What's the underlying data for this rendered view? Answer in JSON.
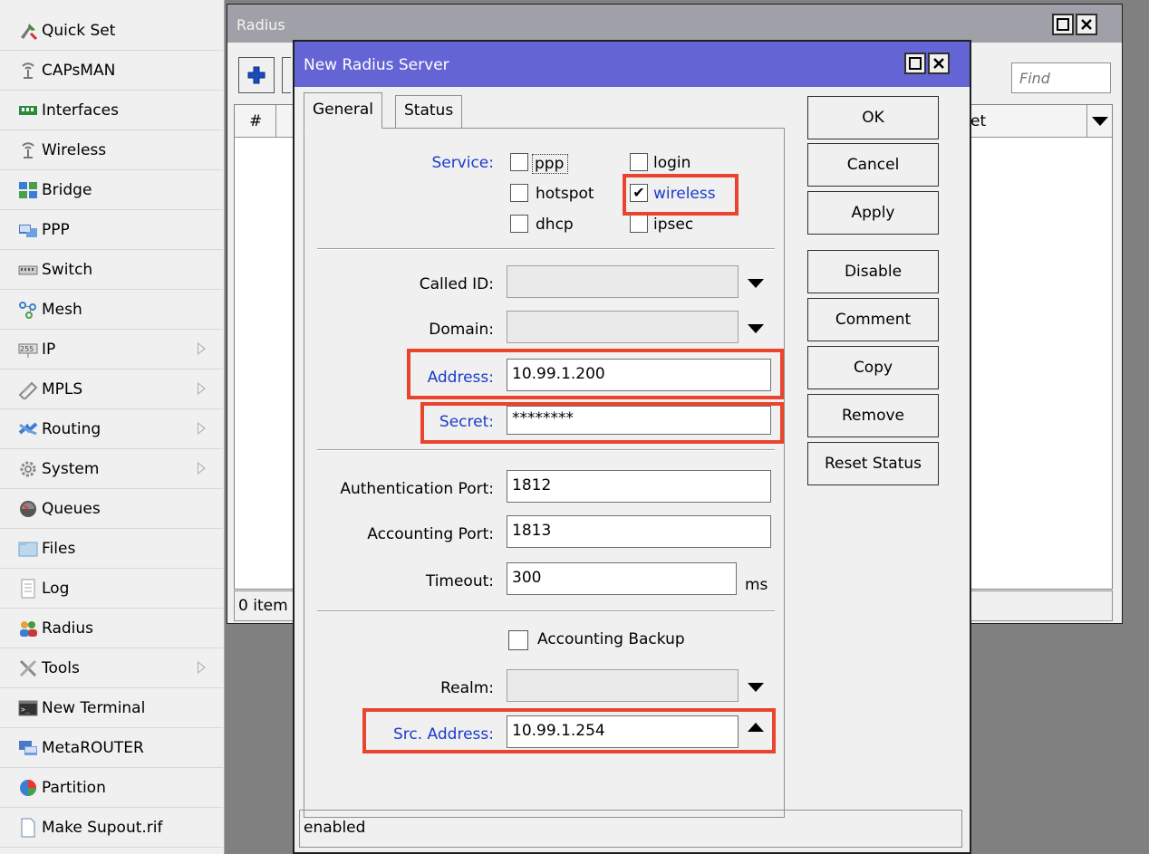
{
  "sidebar": {
    "items": [
      {
        "label": "Quick Set",
        "icon": "quick-set-icon",
        "arrow": false
      },
      {
        "label": "CAPsMAN",
        "icon": "antenna-icon",
        "arrow": false
      },
      {
        "label": "Interfaces",
        "icon": "interfaces-icon",
        "arrow": false
      },
      {
        "label": "Wireless",
        "icon": "wireless-icon",
        "arrow": false
      },
      {
        "label": "Bridge",
        "icon": "bridge-icon",
        "arrow": false
      },
      {
        "label": "PPP",
        "icon": "ppp-icon",
        "arrow": false
      },
      {
        "label": "Switch",
        "icon": "switch-icon",
        "arrow": false
      },
      {
        "label": "Mesh",
        "icon": "mesh-icon",
        "arrow": false
      },
      {
        "label": "IP",
        "icon": "ip-icon",
        "arrow": true
      },
      {
        "label": "MPLS",
        "icon": "mpls-icon",
        "arrow": true
      },
      {
        "label": "Routing",
        "icon": "routing-icon",
        "arrow": true
      },
      {
        "label": "System",
        "icon": "system-gear-icon",
        "arrow": true
      },
      {
        "label": "Queues",
        "icon": "queues-icon",
        "arrow": false
      },
      {
        "label": "Files",
        "icon": "folder-icon",
        "arrow": false
      },
      {
        "label": "Log",
        "icon": "log-icon",
        "arrow": false
      },
      {
        "label": "Radius",
        "icon": "radius-users-icon",
        "arrow": false
      },
      {
        "label": "Tools",
        "icon": "tools-icon",
        "arrow": true
      },
      {
        "label": "New Terminal",
        "icon": "terminal-icon",
        "arrow": false
      },
      {
        "label": "MetaROUTER",
        "icon": "metarouter-icon",
        "arrow": false
      },
      {
        "label": "Partition",
        "icon": "partition-icon",
        "arrow": false
      },
      {
        "label": "Make Supout.rif",
        "icon": "document-icon",
        "arrow": false
      }
    ]
  },
  "radius_window": {
    "title": "Radius",
    "add_icon": "plus-icon",
    "find_placeholder": "Find",
    "col_num": "#",
    "col_partial": "et",
    "status": "0 item"
  },
  "dialog": {
    "title": "New Radius Server",
    "tabs": [
      "General",
      "Status"
    ],
    "service": {
      "label": "Service:",
      "options": [
        {
          "label": "ppp",
          "checked": false
        },
        {
          "label": "login",
          "checked": false
        },
        {
          "label": "hotspot",
          "checked": false
        },
        {
          "label": "wireless",
          "checked": true
        },
        {
          "label": "dhcp",
          "checked": false
        },
        {
          "label": "ipsec",
          "checked": false
        }
      ]
    },
    "fields": {
      "called_id": {
        "label": "Called ID:",
        "value": ""
      },
      "domain": {
        "label": "Domain:",
        "value": ""
      },
      "address": {
        "label": "Address:",
        "value": "10.99.1.200"
      },
      "secret": {
        "label": "Secret:",
        "value": "********"
      },
      "auth_port": {
        "label": "Authentication Port:",
        "value": "1812"
      },
      "acct_port": {
        "label": "Accounting Port:",
        "value": "1813"
      },
      "timeout": {
        "label": "Timeout:",
        "value": "300",
        "unit": "ms"
      },
      "accounting_backup": {
        "label": "Accounting Backup",
        "checked": false
      },
      "realm": {
        "label": "Realm:",
        "value": ""
      },
      "src_address": {
        "label": "Src. Address:",
        "value": "10.99.1.254"
      }
    },
    "buttons": [
      "OK",
      "Cancel",
      "Apply",
      "Disable",
      "Comment",
      "Copy",
      "Remove",
      "Reset Status"
    ],
    "status": "enabled"
  },
  "colors": {
    "highlight": "#e8452c",
    "dialog_title": "#6464d4",
    "blue_label": "#1a3ccc"
  }
}
